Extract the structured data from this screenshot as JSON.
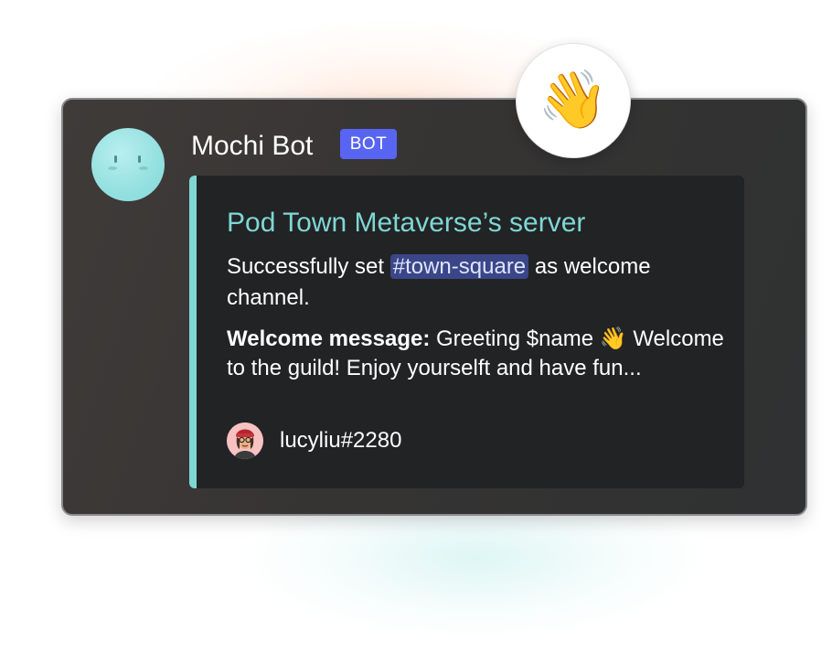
{
  "message": {
    "author": "Mochi Bot",
    "badge": "BOT",
    "reaction_emoji": "👋",
    "embed": {
      "title": "Pod Town Metaverse’s server",
      "description_before": "Successfully set ",
      "channel_mention": "#town-square",
      "description_after": " as welcome channel.",
      "welcome_label": "Welcome message:",
      "welcome_text": " Greeting $name 👋 Welcome to the guild! Enjoy yourselft and have fun...",
      "footer_user": "lucyliu#2280",
      "accent_color": "#7fd7d4"
    },
    "badge_color": "#5865f2",
    "avatar_color": "#94e0e0"
  }
}
